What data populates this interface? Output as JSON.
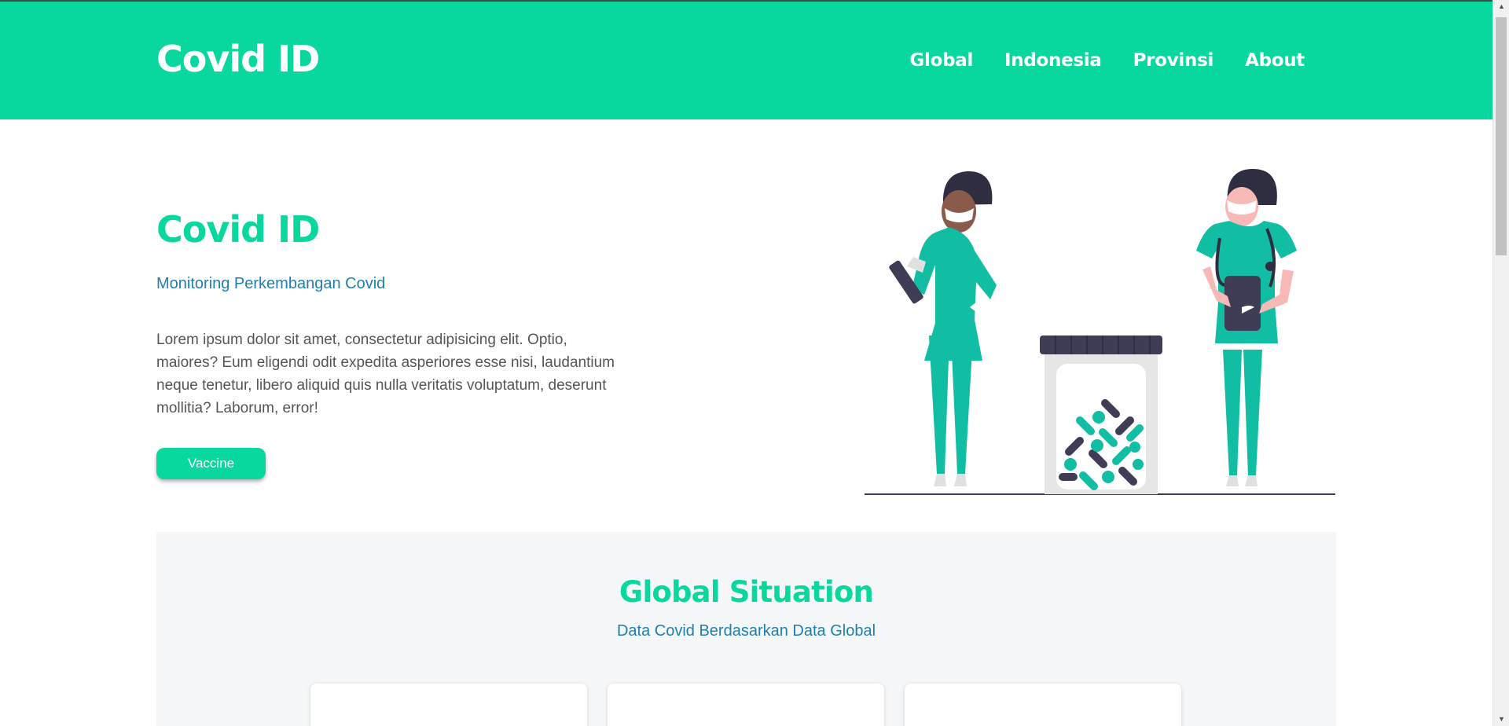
{
  "navbar": {
    "brand": "Covid ID",
    "links": [
      "Global",
      "Indonesia",
      "Provinsi",
      "About"
    ]
  },
  "hero": {
    "title": "Covid ID",
    "subtitle": "Monitoring Perkembangan Covid",
    "text": "Lorem ipsum dolor sit amet, consectetur adipisicing elit. Optio, maiores? Eum eligendi odit expedita asperiores esse nisi, laudantium neque tenetur, libero aliquid quis nulla veritatis voluptatum, deserunt mollitia? Laborum, error!",
    "button_label": "Vaccine"
  },
  "global_section": {
    "title": "Global Situation",
    "subtitle": "Data Covid Berdasarkan Data Global"
  },
  "colors": {
    "accent": "#08d79e",
    "subtitle_blue": "#1f7fae",
    "body_text": "#555555",
    "scrub_green": "#11bea3",
    "dark": "#3f3d56"
  },
  "icons": {
    "scroll_up": "triangle-up",
    "scroll_down": "triangle-down"
  }
}
